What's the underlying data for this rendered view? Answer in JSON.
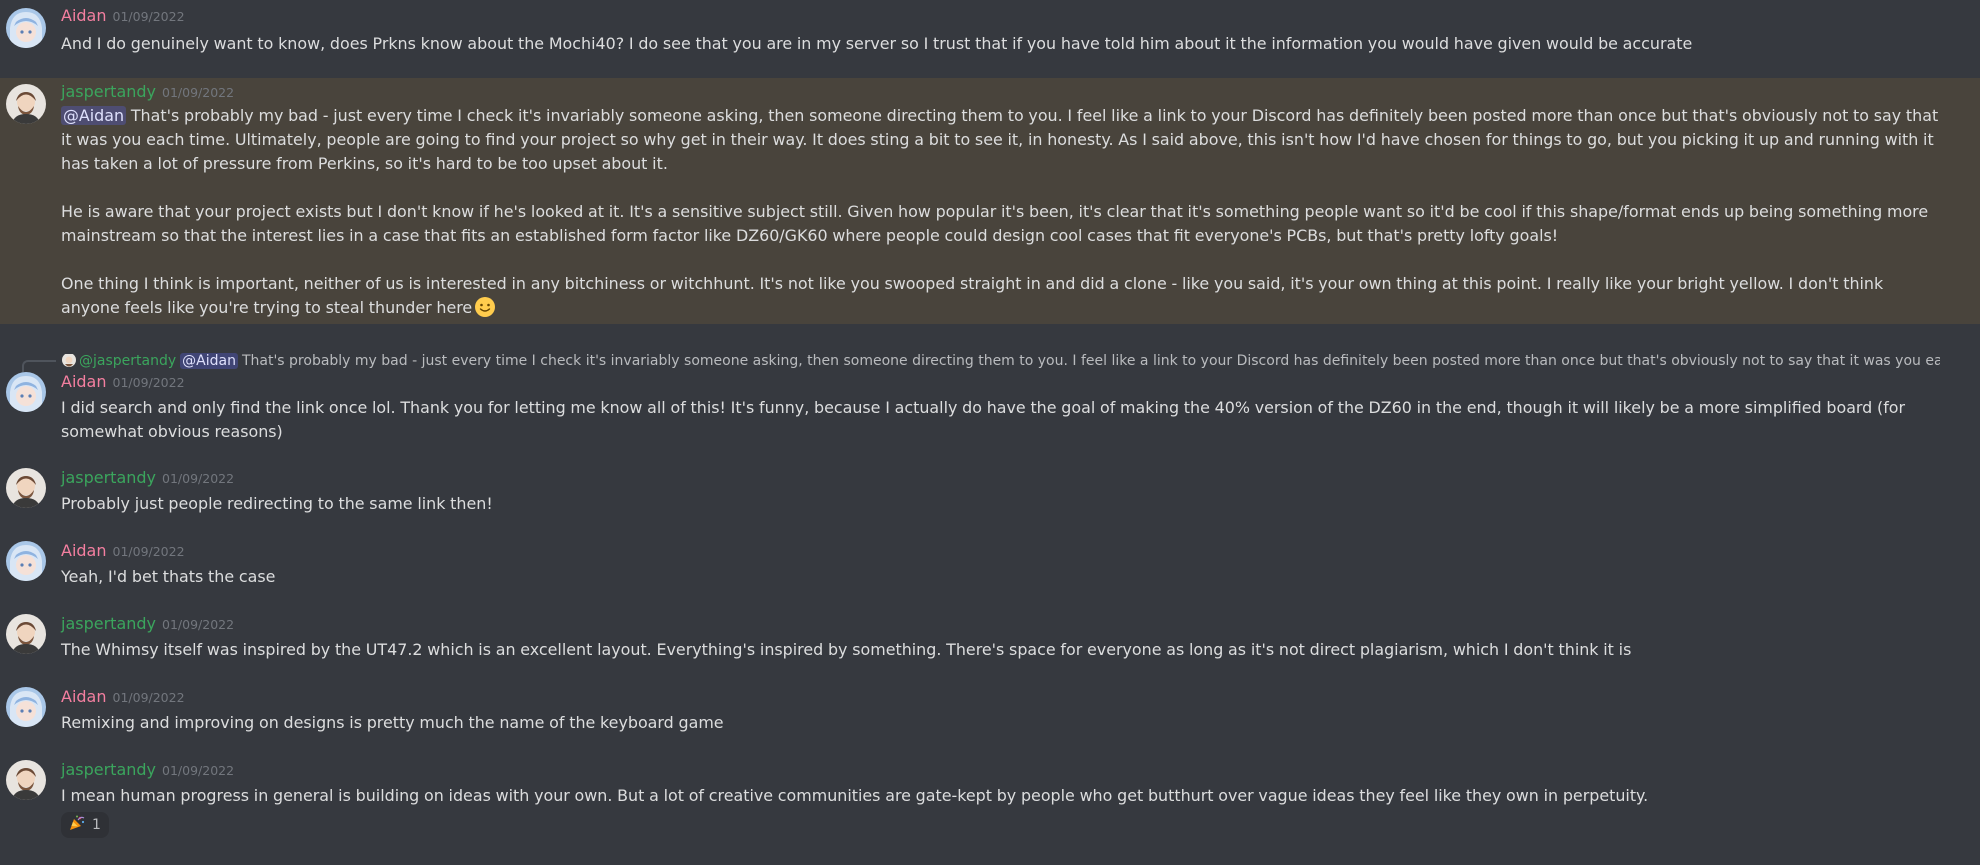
{
  "colors": {
    "background": "#36393f",
    "highlight_background": "#49443c",
    "aidan_color": "#f47fa0",
    "jaspertandy_color": "#3ba55d",
    "timestamp_color": "#72767d",
    "text_color": "#dcddde",
    "mention_background": "#5865f24d"
  },
  "messages": [
    {
      "author": "Aidan",
      "timestamp": "01/09/2022",
      "text": "And I do genuinely want to know, does Prkns know about the Mochi40? I do see that you are in my server so I trust that if you have told him about it the information you would have given would be accurate"
    },
    {
      "author": "jaspertandy",
      "timestamp": "01/09/2022",
      "mention": "@Aidan",
      "paragraphs": [
        "That's probably my bad - just every time I check it's invariably someone asking, then someone directing them to you. I feel like a link to your Discord has definitely been posted more than once but that's obviously not to say that it was you each time. Ultimately, people are going to find your project so why get in their way. It does sting a bit to see it, in honesty. As I said above, this isn't how I'd have chosen for things to go, but you picking it up and running with it has taken a lot of pressure from Perkins, so it's hard to be too upset about it.",
        "He is aware that your project exists but I don't know if he's looked at it. It's a sensitive subject still. Given how popular it's been, it's clear that it's something people want so it'd be cool if this shape/format ends up being something more mainstream so that the interest lies in a case that fits an established form factor like DZ60/GK60 where people could design cool cases that fit everyone's PCBs, but that's pretty lofty goals!",
        "One thing I think is important, neither of us is interested in any bitchiness or witchhunt. It's not like you swooped straight in and did a clone - like you said, it's your own thing at this point. I really like your bright yellow. I don't think anyone feels like you're trying to steal thunder here"
      ]
    },
    {
      "reply": {
        "author": "@jaspertandy",
        "mention": "@Aidan",
        "text": "That's probably my bad - just every time I check it's invariably someone asking, then someone directing them to you. I feel like a link to your Discord has definitely been posted more than once but that's obviously not to say that it was you each time. Ultimately..."
      },
      "author": "Aidan",
      "timestamp": "01/09/2022",
      "text": "I did search and only find the link once lol. Thank you for letting me know all of this! It's funny, because I actually do have the goal of making the 40% version of the DZ60 in the end, though it will likely be a more simplified board (for somewhat obvious reasons)"
    },
    {
      "author": "jaspertandy",
      "timestamp": "01/09/2022",
      "text": "Probably just people redirecting to the same link then!"
    },
    {
      "author": "Aidan",
      "timestamp": "01/09/2022",
      "text": "Yeah, I'd bet thats the case"
    },
    {
      "author": "jaspertandy",
      "timestamp": "01/09/2022",
      "text": "The Whimsy itself was inspired by the UT47.2 which is an excellent layout. Everything's inspired by something. There's space for everyone as long as it's not direct plagiarism, which I don't think it is"
    },
    {
      "author": "Aidan",
      "timestamp": "01/09/2022",
      "text": "Remixing and improving on designs is pretty much the name of the keyboard game"
    },
    {
      "author": "jaspertandy",
      "timestamp": "01/09/2022",
      "text": "I mean human progress in general is building on ideas with your own. But a lot of creative communities are gate-kept by people who get butthurt over vague ideas they feel like they own in perpetuity.",
      "reaction": {
        "icon": "party-popper-icon",
        "count": "1"
      }
    }
  ]
}
